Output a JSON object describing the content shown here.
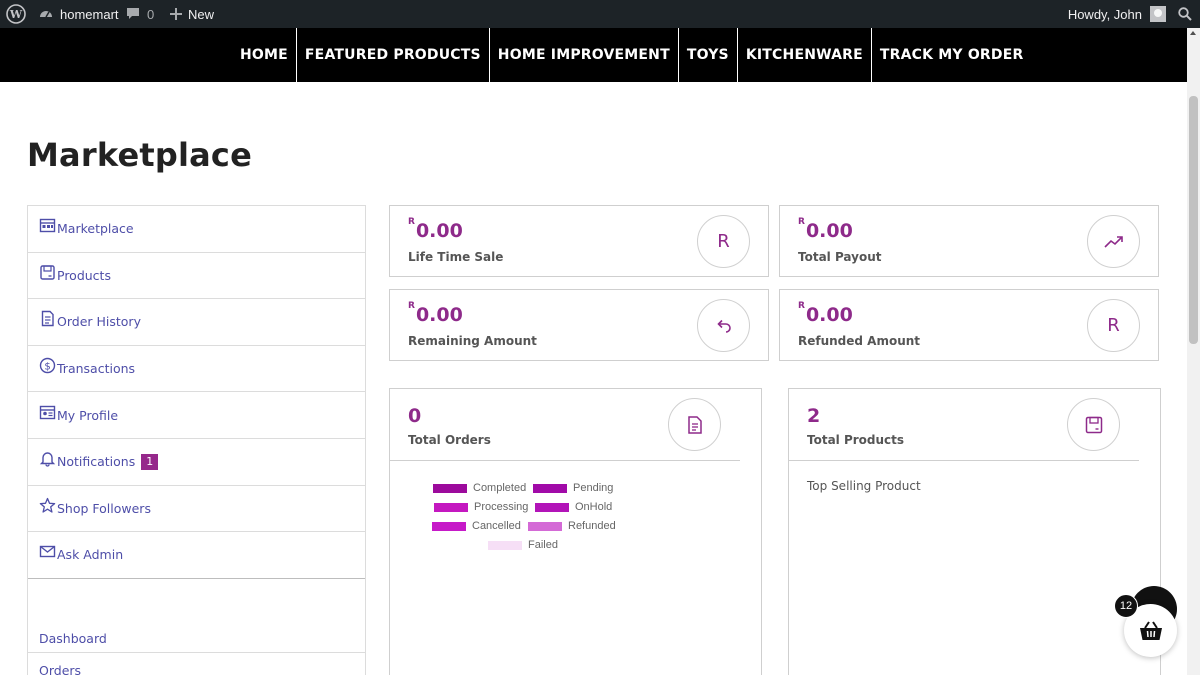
{
  "adminbar": {
    "site_name": "homemart",
    "comments_count": "0",
    "new_label": "New",
    "howdy": "Howdy, John"
  },
  "nav": {
    "items": [
      "HOME",
      "FEATURED PRODUCTS",
      "HOME IMPROVEMENT",
      "TOYS",
      "KITCHENWARE",
      "TRACK MY ORDER"
    ]
  },
  "page": {
    "title": "Marketplace"
  },
  "sidebar": {
    "items": [
      {
        "label": "Marketplace",
        "icon": "marketplace-icon"
      },
      {
        "label": "Products",
        "icon": "products-icon"
      },
      {
        "label": "Order History",
        "icon": "order-history-icon"
      },
      {
        "label": "Transactions",
        "icon": "dollar-icon"
      },
      {
        "label": "My Profile",
        "icon": "profile-icon"
      },
      {
        "label": "Notifications",
        "icon": "bell-icon",
        "badge": "1"
      },
      {
        "label": "Shop Followers",
        "icon": "star-icon"
      },
      {
        "label": "Ask Admin",
        "icon": "mail-icon"
      }
    ],
    "extra": [
      {
        "label": "Dashboard"
      },
      {
        "label": "Orders"
      }
    ]
  },
  "cards": [
    {
      "currency": "R",
      "amount": "0.00",
      "label": "Life Time Sale",
      "icon": "rand-icon",
      "icon_text": "R"
    },
    {
      "currency": "R",
      "amount": "0.00",
      "label": "Total Payout",
      "icon": "trend-up-icon"
    },
    {
      "currency": "R",
      "amount": "0.00",
      "label": "Remaining Amount",
      "icon": "undo-icon"
    },
    {
      "currency": "R",
      "amount": "0.00",
      "label": "Refunded Amount",
      "icon": "rand-icon",
      "icon_text": "R"
    }
  ],
  "orders_panel": {
    "value": "0",
    "label": "Total Orders",
    "icon": "document-icon",
    "legend": [
      {
        "label": "Completed",
        "color": "#9c0a9c"
      },
      {
        "label": "Pending",
        "color": "#a10aa8"
      },
      {
        "label": "Processing",
        "color": "#c418c0"
      },
      {
        "label": "OnHold",
        "color": "#b214b8"
      },
      {
        "label": "Cancelled",
        "color": "#c61ac8"
      },
      {
        "label": "Refunded",
        "color": "#d46ad6"
      },
      {
        "label": "Failed",
        "color": "#f6dff6"
      }
    ]
  },
  "products_panel": {
    "value": "2",
    "label": "Total Products",
    "icon": "product-box-icon",
    "subheading": "Top Selling Product"
  },
  "cart": {
    "count": "12"
  },
  "colors": {
    "accent": "#8e2a8a",
    "link": "#4e4ea8",
    "nav_bg": "#000000",
    "adminbar_bg": "#1d2327"
  }
}
